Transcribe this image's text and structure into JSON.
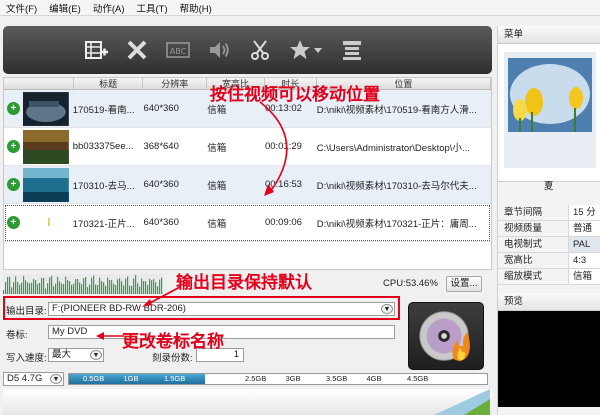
{
  "menubar": [
    "文件(F)",
    "编辑(E)",
    "动作(A)",
    "工具(T)",
    "帮助(H)"
  ],
  "toolbar": {
    "icons": [
      "add-video-icon",
      "delete-icon",
      "subtitle-icon",
      "audio-icon",
      "edit-icon",
      "effect-icon",
      "menu-icon"
    ]
  },
  "table": {
    "headers": [
      "",
      "标题",
      "分辨率",
      "宽高比",
      "时长",
      "位置"
    ],
    "rows": [
      {
        "title": "170519-看南...",
        "resolution": "640*360",
        "aspect": "信箱",
        "duration": "00:13:02",
        "path": "D:\\niki\\视频素材\\170519-看南方人滑..."
      },
      {
        "title": "bb033375ee...",
        "resolution": "368*640",
        "aspect": "信箱",
        "duration": "00:01:29",
        "path": "C:\\Users\\Administrator\\Desktop\\小..."
      },
      {
        "title": "170310-去马...",
        "resolution": "640*360",
        "aspect": "信箱",
        "duration": "00:16:53",
        "path": "D:\\niki\\视频素材\\170310-去马尔代夫..."
      },
      {
        "title": "170321-正片...",
        "resolution": "640*360",
        "aspect": "信箱",
        "duration": "00:09:06",
        "path": "D:\\niki\\视频素材\\170321-正片：庸周..."
      }
    ]
  },
  "status": {
    "cpu": "CPU:53.46%",
    "settings_label": "设置..."
  },
  "output": {
    "label": "输出目录:",
    "value": "F:(PIONEER BD-RW   BDR-206)"
  },
  "volume": {
    "label": "卷标:",
    "value": "My DVD"
  },
  "write_speed": {
    "label": "写入速度:",
    "value": "最大"
  },
  "copies": {
    "label": "刻录份数:",
    "value": "1"
  },
  "disc": {
    "type": "D5 4.7G",
    "ticks": [
      "0.5GB",
      "1GB",
      "1.5GB",
      "2GB",
      "2.5GB",
      "3GB",
      "3.5GB",
      "4GB",
      "4.5GB"
    ],
    "used_fraction": 0.325
  },
  "right_panel": {
    "menu_title": "菜单",
    "thumb_caption": "夏",
    "props": [
      {
        "k": "章节间隔",
        "v": "15 分"
      },
      {
        "k": "视频质量",
        "v": "普通"
      },
      {
        "k": "电视制式",
        "v": "PAL"
      },
      {
        "k": "宽高比",
        "v": "4:3"
      },
      {
        "k": "缩放模式",
        "v": "信箱"
      }
    ],
    "preview_title": "预览"
  },
  "annotations": {
    "move": "按住视频可以移动位置",
    "output": "输出目录保持默认",
    "volume": "更改卷标名称"
  },
  "colors": {
    "annotation": "#e3001b",
    "toolbar": "#3b3b3b",
    "selection_bar": "#2680b8"
  }
}
